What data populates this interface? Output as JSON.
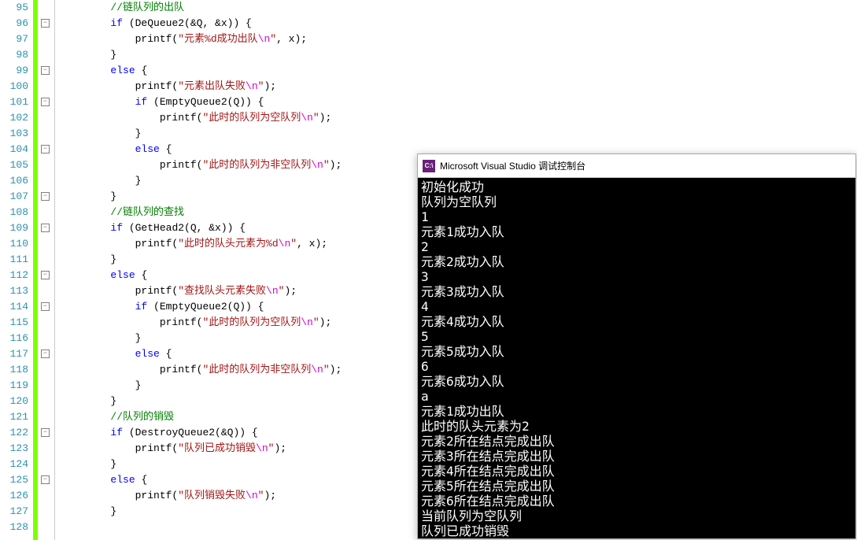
{
  "lineStart": 95,
  "lineEnd": 128,
  "foldRows": [
    2,
    5,
    7,
    10,
    13,
    15,
    18,
    20,
    23,
    28,
    31
  ],
  "code": [
    [
      [
        "        ",
        ""
      ],
      [
        "//链队列的出队",
        "c-comment"
      ]
    ],
    [
      [
        "        ",
        ""
      ],
      [
        "if",
        "c-kw"
      ],
      [
        " (DeQueue2(&Q, &x)) {",
        ""
      ]
    ],
    [
      [
        "            printf(",
        ""
      ],
      [
        "\"元素%d成功出队",
        "c-str"
      ],
      [
        "\\n",
        "c-esc"
      ],
      [
        "\"",
        "c-str"
      ],
      [
        ", x);",
        ""
      ]
    ],
    [
      [
        "        }",
        ""
      ]
    ],
    [
      [
        "        ",
        ""
      ],
      [
        "else",
        "c-kw"
      ],
      [
        " {",
        ""
      ]
    ],
    [
      [
        "            printf(",
        ""
      ],
      [
        "\"元素出队失败",
        "c-str"
      ],
      [
        "\\n",
        "c-esc"
      ],
      [
        "\"",
        "c-str"
      ],
      [
        ");",
        ""
      ]
    ],
    [
      [
        "            ",
        ""
      ],
      [
        "if",
        "c-kw"
      ],
      [
        " (EmptyQueue2(Q)) {",
        ""
      ]
    ],
    [
      [
        "                printf(",
        ""
      ],
      [
        "\"此时的队列为空队列",
        "c-str"
      ],
      [
        "\\n",
        "c-esc"
      ],
      [
        "\"",
        "c-str"
      ],
      [
        ");",
        ""
      ]
    ],
    [
      [
        "            }",
        ""
      ]
    ],
    [
      [
        "            ",
        ""
      ],
      [
        "else",
        "c-kw"
      ],
      [
        " {",
        ""
      ]
    ],
    [
      [
        "                printf(",
        ""
      ],
      [
        "\"此时的队列为非空队列",
        "c-str"
      ],
      [
        "\\n",
        "c-esc"
      ],
      [
        "\"",
        "c-str"
      ],
      [
        ");",
        ""
      ]
    ],
    [
      [
        "            }",
        ""
      ]
    ],
    [
      [
        "        }",
        ""
      ]
    ],
    [
      [
        "        ",
        ""
      ],
      [
        "//链队列的查找",
        "c-comment"
      ]
    ],
    [
      [
        "        ",
        ""
      ],
      [
        "if",
        "c-kw"
      ],
      [
        " (GetHead2(Q, &x)) {",
        ""
      ]
    ],
    [
      [
        "            printf(",
        ""
      ],
      [
        "\"此时的队头元素为%d",
        "c-str"
      ],
      [
        "\\n",
        "c-esc"
      ],
      [
        "\"",
        "c-str"
      ],
      [
        ", x);",
        ""
      ]
    ],
    [
      [
        "        }",
        ""
      ]
    ],
    [
      [
        "        ",
        ""
      ],
      [
        "else",
        "c-kw"
      ],
      [
        " {",
        ""
      ]
    ],
    [
      [
        "            printf(",
        ""
      ],
      [
        "\"查找队头元素失败",
        "c-str"
      ],
      [
        "\\n",
        "c-esc"
      ],
      [
        "\"",
        "c-str"
      ],
      [
        ");",
        ""
      ]
    ],
    [
      [
        "            ",
        ""
      ],
      [
        "if",
        "c-kw"
      ],
      [
        " (EmptyQueue2(Q)) {",
        ""
      ]
    ],
    [
      [
        "                printf(",
        ""
      ],
      [
        "\"此时的队列为空队列",
        "c-str"
      ],
      [
        "\\n",
        "c-esc"
      ],
      [
        "\"",
        "c-str"
      ],
      [
        ");",
        ""
      ]
    ],
    [
      [
        "            }",
        ""
      ]
    ],
    [
      [
        "            ",
        ""
      ],
      [
        "else",
        "c-kw"
      ],
      [
        " {",
        ""
      ]
    ],
    [
      [
        "                printf(",
        ""
      ],
      [
        "\"此时的队列为非空队列",
        "c-str"
      ],
      [
        "\\n",
        "c-esc"
      ],
      [
        "\"",
        "c-str"
      ],
      [
        ");",
        ""
      ]
    ],
    [
      [
        "            }",
        ""
      ]
    ],
    [
      [
        "        }",
        ""
      ]
    ],
    [
      [
        "        ",
        ""
      ],
      [
        "//队列的销毁",
        "c-comment"
      ]
    ],
    [
      [
        "        ",
        ""
      ],
      [
        "if",
        "c-kw"
      ],
      [
        " (DestroyQueue2(&Q)) {",
        ""
      ]
    ],
    [
      [
        "            printf(",
        ""
      ],
      [
        "\"队列已成功销毁",
        "c-str"
      ],
      [
        "\\n",
        "c-esc"
      ],
      [
        "\"",
        "c-str"
      ],
      [
        ");",
        ""
      ]
    ],
    [
      [
        "        }",
        ""
      ]
    ],
    [
      [
        "        ",
        ""
      ],
      [
        "else",
        "c-kw"
      ],
      [
        " {",
        ""
      ]
    ],
    [
      [
        "            printf(",
        ""
      ],
      [
        "\"队列销毁失败",
        "c-str"
      ],
      [
        "\\n",
        "c-esc"
      ],
      [
        "\"",
        "c-str"
      ],
      [
        ");",
        ""
      ]
    ],
    [
      [
        "        }",
        ""
      ]
    ],
    [
      [
        "",
        ""
      ]
    ]
  ],
  "console": {
    "title": "Microsoft Visual Studio 调试控制台",
    "iconText": "C:\\",
    "lines": [
      "初始化成功",
      "队列为空队列",
      "1",
      "元素1成功入队",
      "2",
      "元素2成功入队",
      "3",
      "元素3成功入队",
      "4",
      "元素4成功入队",
      "5",
      "元素5成功入队",
      "6",
      "元素6成功入队",
      "a",
      "元素1成功出队",
      "此时的队头元素为2",
      "元素2所在结点完成出队",
      "元素3所在结点完成出队",
      "元素4所在结点完成出队",
      "元素5所在结点完成出队",
      "元素6所在结点完成出队",
      "当前队列为空队列",
      "队列已成功销毁"
    ]
  }
}
